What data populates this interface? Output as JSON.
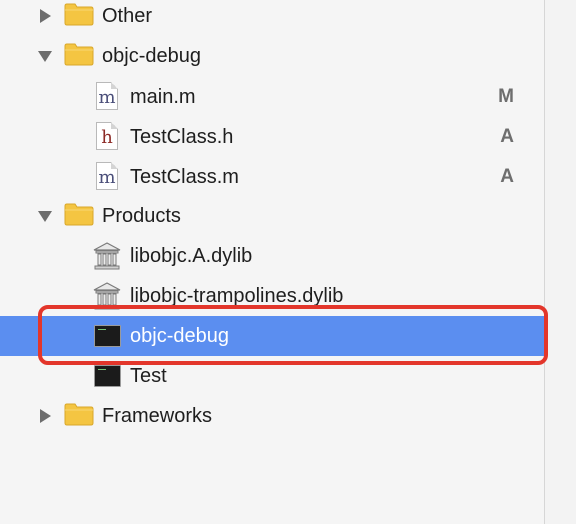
{
  "tree": {
    "rows": [
      {
        "label": "Other",
        "kind": "folder",
        "state": "collapsed",
        "status": ""
      },
      {
        "label": "objc-debug",
        "kind": "folder",
        "state": "expanded",
        "status": ""
      },
      {
        "label": "main.m",
        "kind": "source-m",
        "icon_glyph": "m",
        "status": "M"
      },
      {
        "label": "TestClass.h",
        "kind": "header-h",
        "icon_glyph": "h",
        "status": "A"
      },
      {
        "label": "TestClass.m",
        "kind": "source-m",
        "icon_glyph": "m",
        "status": "A"
      },
      {
        "label": "Products",
        "kind": "folder",
        "state": "expanded",
        "status": ""
      },
      {
        "label": "libobjc.A.dylib",
        "kind": "library",
        "status": ""
      },
      {
        "label": "libobjc-trampolines.dylib",
        "kind": "library",
        "status": ""
      },
      {
        "label": "objc-debug",
        "kind": "executable",
        "selected": true,
        "status": ""
      },
      {
        "label": "Test",
        "kind": "executable",
        "status": ""
      },
      {
        "label": "Frameworks",
        "kind": "folder",
        "state": "collapsed",
        "status": ""
      }
    ]
  },
  "colors": {
    "selection": "#5b8ef0",
    "highlight_outline": "#e3362b",
    "folder": "#f4c542",
    "background": "#f5f5f5"
  }
}
